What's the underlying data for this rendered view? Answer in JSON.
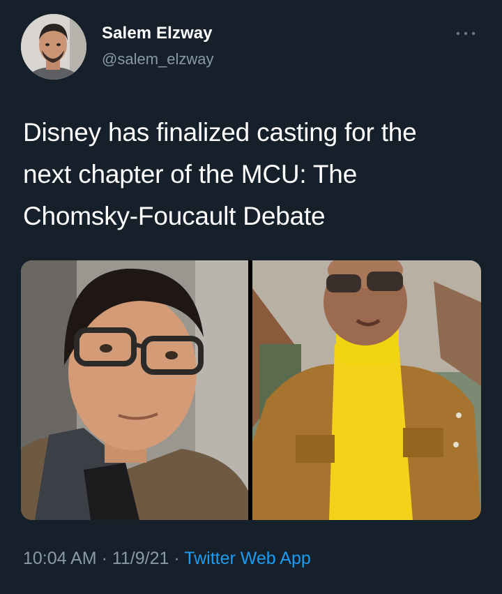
{
  "tweet": {
    "author": {
      "name": "Salem Elzway",
      "handle": "@salem_elzway"
    },
    "more_label": "···",
    "text": "Disney has finalized casting for the\nnext chapter of the MCU:  The\nChomsky-Foucault Debate",
    "media": [
      {
        "label": "Photo of a man with dark hair wearing glasses, a checked shirt and tweed jacket"
      },
      {
        "label": "Photo of a bald man in sunglasses, yellow turtleneck and suede jacket"
      }
    ],
    "meta": {
      "time": "10:04 AM",
      "separator": " · ",
      "date": "11/9/21",
      "source": "Twitter Web App"
    }
  },
  "colors": {
    "background": "#15202b",
    "text_primary": "#ffffff",
    "text_secondary": "#8b98a5",
    "link": "#1d9bf0"
  }
}
